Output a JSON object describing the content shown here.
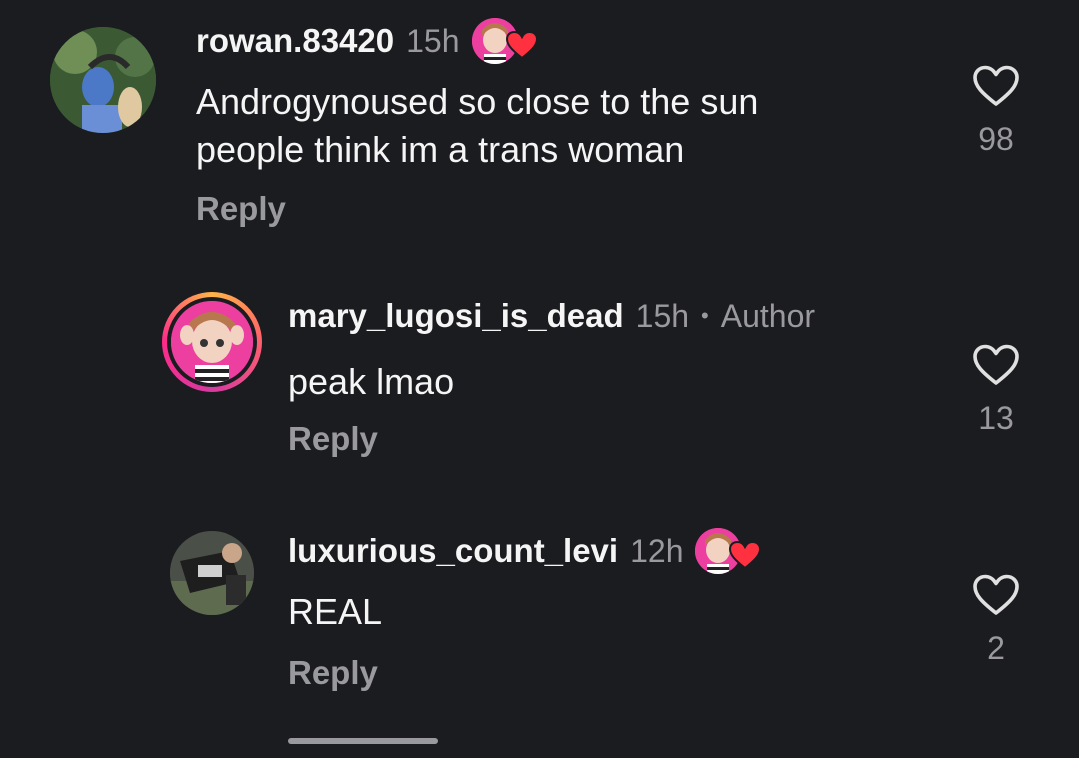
{
  "comments": [
    {
      "username": "rowan.83420",
      "time": "15h",
      "text_line1": "Androgynoused so close to the sun",
      "text_line2": "people think im a trans woman",
      "reply": "Reply",
      "likes": "98",
      "liked_by_author": true
    },
    {
      "username": "mary_lugosi_is_dead",
      "time": "15h",
      "separator": "•",
      "author_tag": "Author",
      "text": "peak lmao",
      "reply": "Reply",
      "likes": "13"
    },
    {
      "username": "luxurious_count_levi",
      "time": "12h",
      "text": "REAL",
      "reply": "Reply",
      "likes": "2",
      "liked_by_author": true
    }
  ],
  "colors": {
    "background": "#1b1c20",
    "text_primary": "#f5f5f5",
    "text_secondary": "#9a9a9e",
    "heart_red": "#ff3040",
    "avatar_pink": "#ec3fa0"
  },
  "icons": {
    "like": "heart-outline-icon",
    "creator_like": "heart-filled-icon"
  }
}
